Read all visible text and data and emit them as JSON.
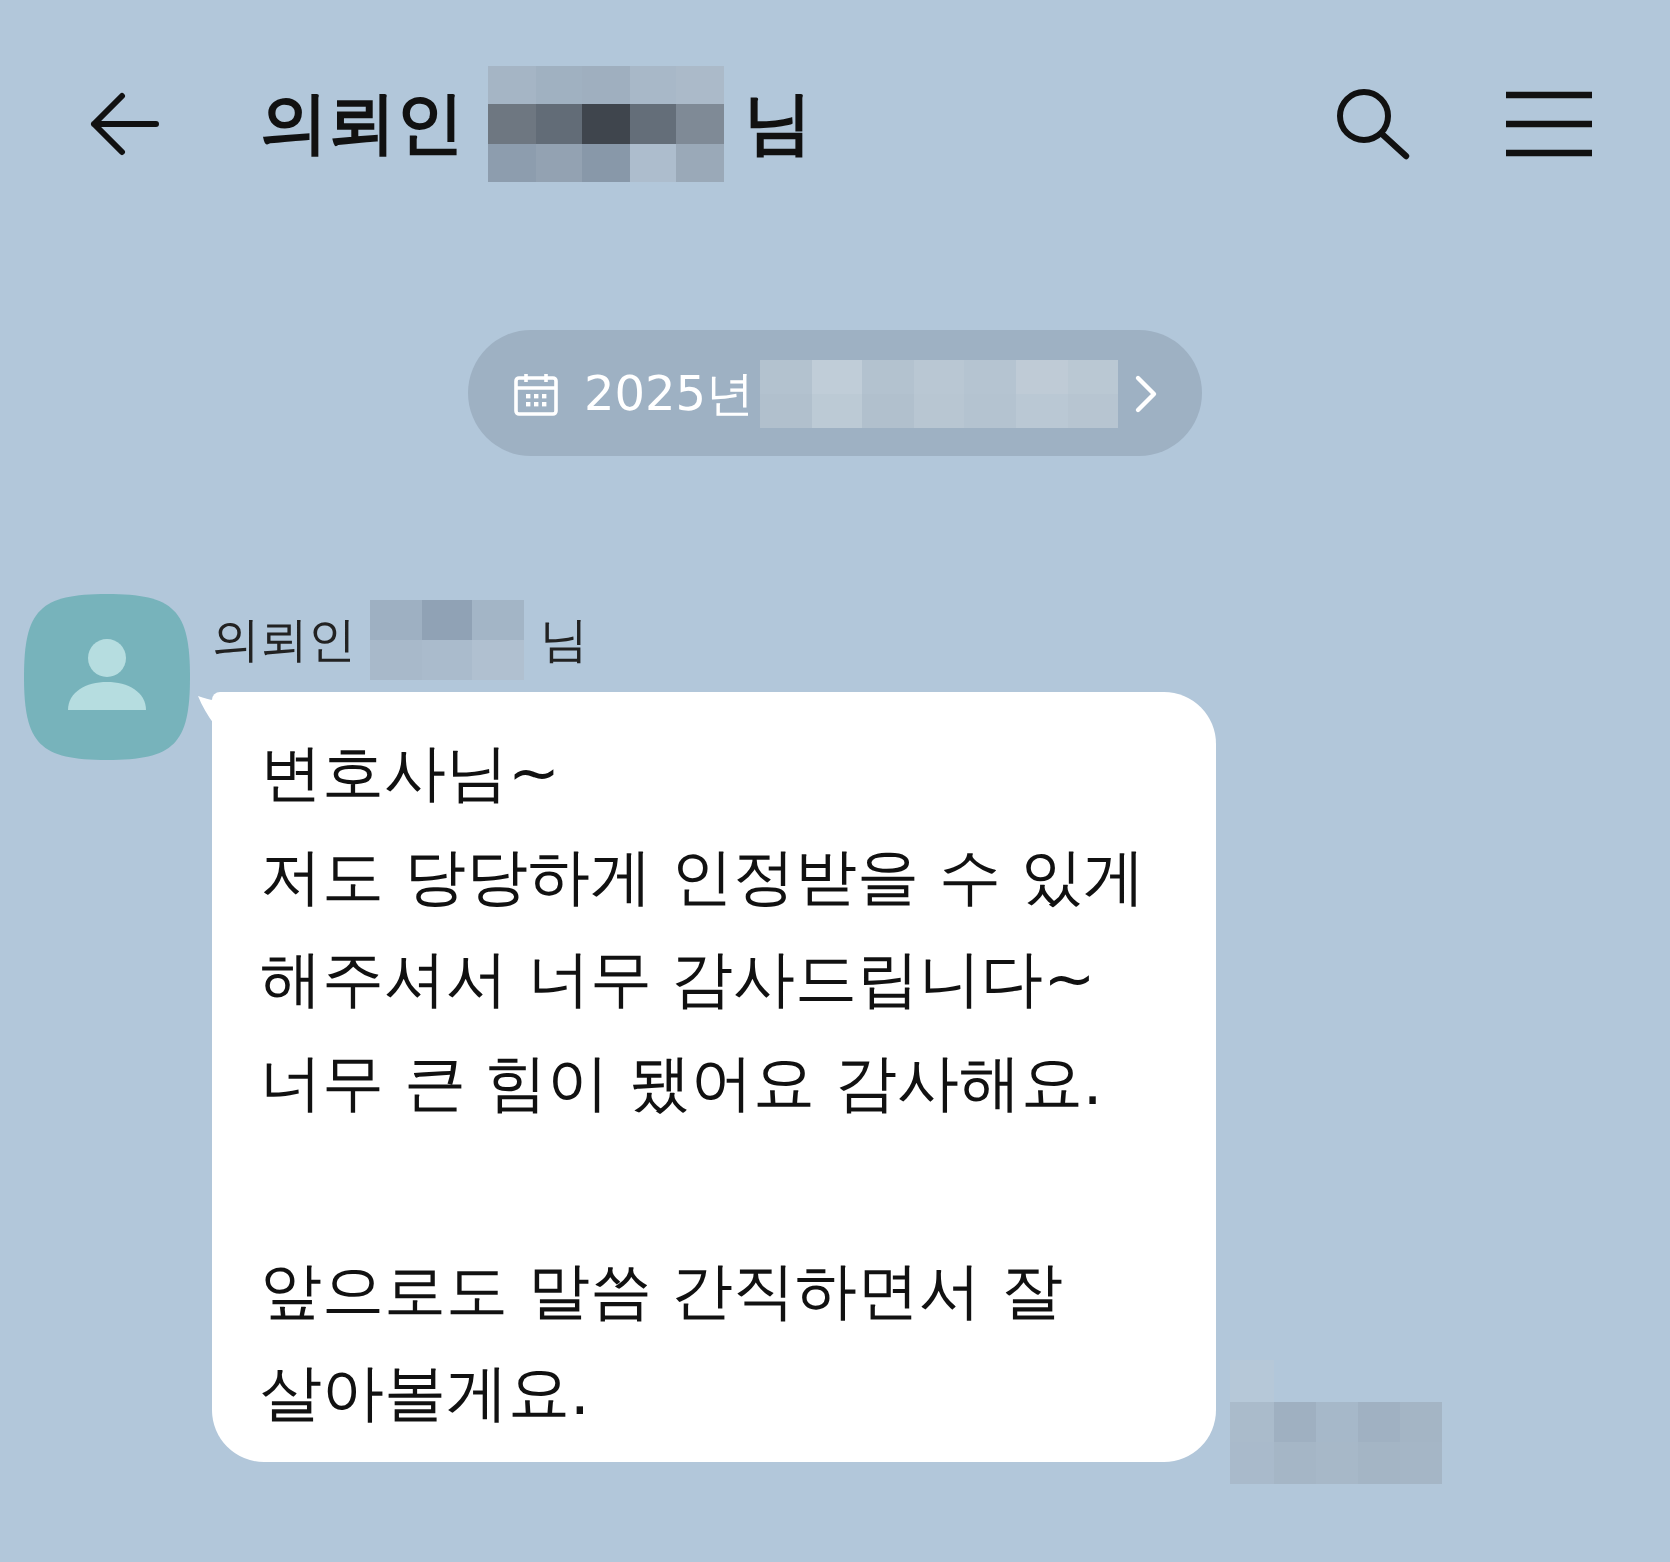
{
  "header": {
    "title_start": "의뢰인",
    "name_pixelated": true,
    "title_end": "님"
  },
  "date_pill": {
    "text": "2025년",
    "rest_pixelated": true
  },
  "messages": [
    {
      "sender_start": "의뢰인",
      "sender_name_pixelated": true,
      "sender_end": "님",
      "text": "변호사님~\n저도 당당하게 인정받을 수 있게\n해주셔서 너무 감사드립니다~\n너무 큰 힘이 됐어요 감사해요.\n\n앞으로도 말씀 간직하면서 잘\n살아볼게요.",
      "time_pixelated": true
    }
  ]
}
